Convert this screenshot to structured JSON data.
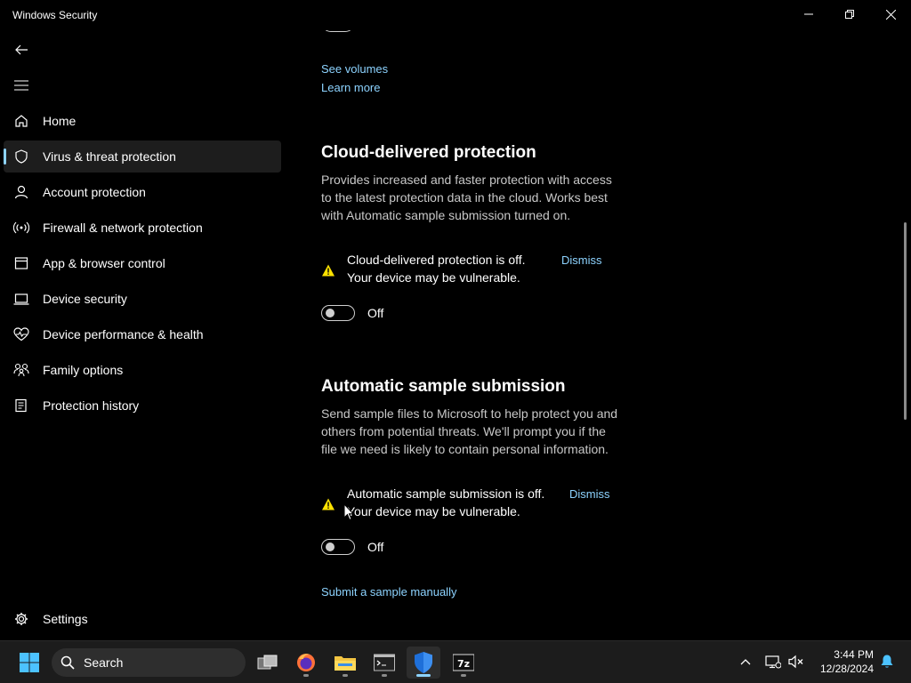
{
  "window": {
    "title": "Windows Security"
  },
  "sidebar": {
    "items": [
      {
        "label": "Home",
        "icon": "home-icon"
      },
      {
        "label": "Virus & threat protection",
        "icon": "shield-icon"
      },
      {
        "label": "Account protection",
        "icon": "person-icon"
      },
      {
        "label": "Firewall & network protection",
        "icon": "wifi-antenna-icon"
      },
      {
        "label": "App & browser control",
        "icon": "browser-window-icon"
      },
      {
        "label": "Device security",
        "icon": "laptop-icon"
      },
      {
        "label": "Device performance & health",
        "icon": "heart-pulse-icon"
      },
      {
        "label": "Family options",
        "icon": "family-icon"
      },
      {
        "label": "Protection history",
        "icon": "history-icon"
      }
    ],
    "active_index": 1,
    "settings_label": "Settings"
  },
  "main": {
    "links_top": {
      "see_volumes": "See volumes",
      "learn_more": "Learn more"
    },
    "cloud": {
      "title": "Cloud-delivered protection",
      "description": "Provides increased and faster protection with access to the latest protection data in the cloud. Works best with Automatic sample submission turned on.",
      "warning_line1": "Cloud-delivered protection is off.",
      "warning_line2": "Your device may be vulnerable.",
      "dismiss": "Dismiss",
      "toggle_state": "Off"
    },
    "sample": {
      "title": "Automatic sample submission",
      "description": "Send sample files to Microsoft to help protect you and others from potential threats. We'll prompt you if the file we need is likely to contain personal information.",
      "warning_line1": "Automatic sample submission is off.",
      "warning_line2": "Your device may be vulnerable.",
      "dismiss": "Dismiss",
      "toggle_state": "Off"
    },
    "submit_link": "Submit a sample manually"
  },
  "taskbar": {
    "search_placeholder": "Search",
    "time": "3:44 PM",
    "date": "12/28/2024"
  },
  "colors": {
    "accent": "#8dd3ff",
    "warning": "#fce100",
    "background": "#000000"
  }
}
